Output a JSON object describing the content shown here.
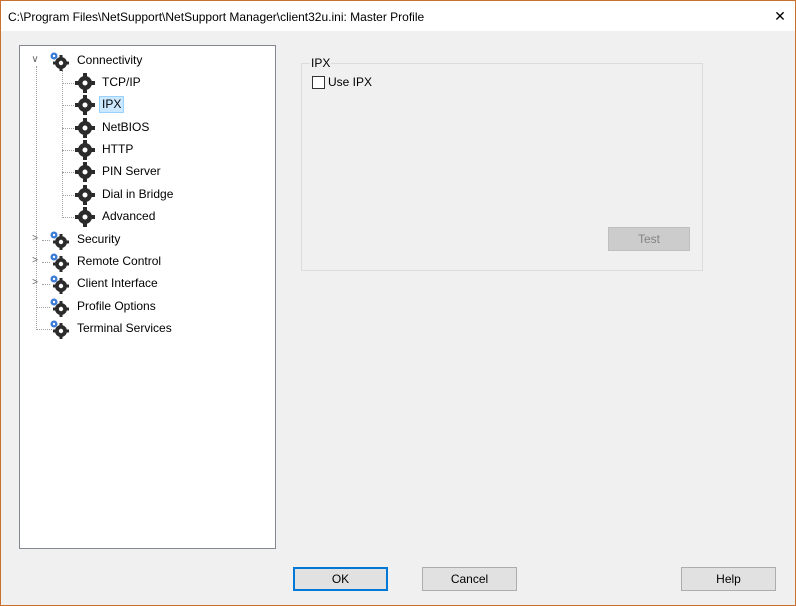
{
  "window": {
    "title": "C:\\Program Files\\NetSupport\\NetSupport Manager\\client32u.ini: Master Profile",
    "close_glyph": "✕"
  },
  "tree": {
    "items": [
      {
        "label": "Connectivity",
        "expander": "chevron-down",
        "icon": "gears-icon",
        "level": 0,
        "selected": false
      },
      {
        "label": "TCP/IP",
        "icon": "gear-icon",
        "level": 1,
        "selected": false
      },
      {
        "label": "IPX",
        "icon": "gear-icon",
        "level": 1,
        "selected": true
      },
      {
        "label": "NetBIOS",
        "icon": "gear-icon",
        "level": 1,
        "selected": false
      },
      {
        "label": "HTTP",
        "icon": "gear-icon",
        "level": 1,
        "selected": false
      },
      {
        "label": "PIN Server",
        "icon": "gear-icon",
        "level": 1,
        "selected": false
      },
      {
        "label": "Dial in Bridge",
        "icon": "gear-icon",
        "level": 1,
        "selected": false
      },
      {
        "label": "Advanced",
        "icon": "gear-icon",
        "level": 1,
        "selected": false
      },
      {
        "label": "Security",
        "expander": "chevron-right",
        "icon": "gears-icon",
        "level": 0,
        "selected": false
      },
      {
        "label": "Remote Control",
        "expander": "chevron-right",
        "icon": "gears-icon",
        "level": 0,
        "selected": false
      },
      {
        "label": "Client Interface",
        "expander": "chevron-right",
        "icon": "gears-icon",
        "level": 0,
        "selected": false
      },
      {
        "label": "Profile Options",
        "icon": "gears-icon",
        "level": 0,
        "selected": false
      },
      {
        "label": "Terminal Services",
        "icon": "gears-icon",
        "level": 0,
        "selected": false
      }
    ]
  },
  "panel": {
    "group_label": "IPX",
    "use_ipx_label": "Use IPX",
    "use_ipx_checked": false,
    "test_label": "Test"
  },
  "buttons": {
    "ok": "OK",
    "cancel": "Cancel",
    "help": "Help"
  },
  "colors": {
    "selection": "#cce8ff",
    "accent": "#0078d7",
    "gear_dark": "#2b2b2b",
    "gear_blue": "#3a7bd5"
  }
}
